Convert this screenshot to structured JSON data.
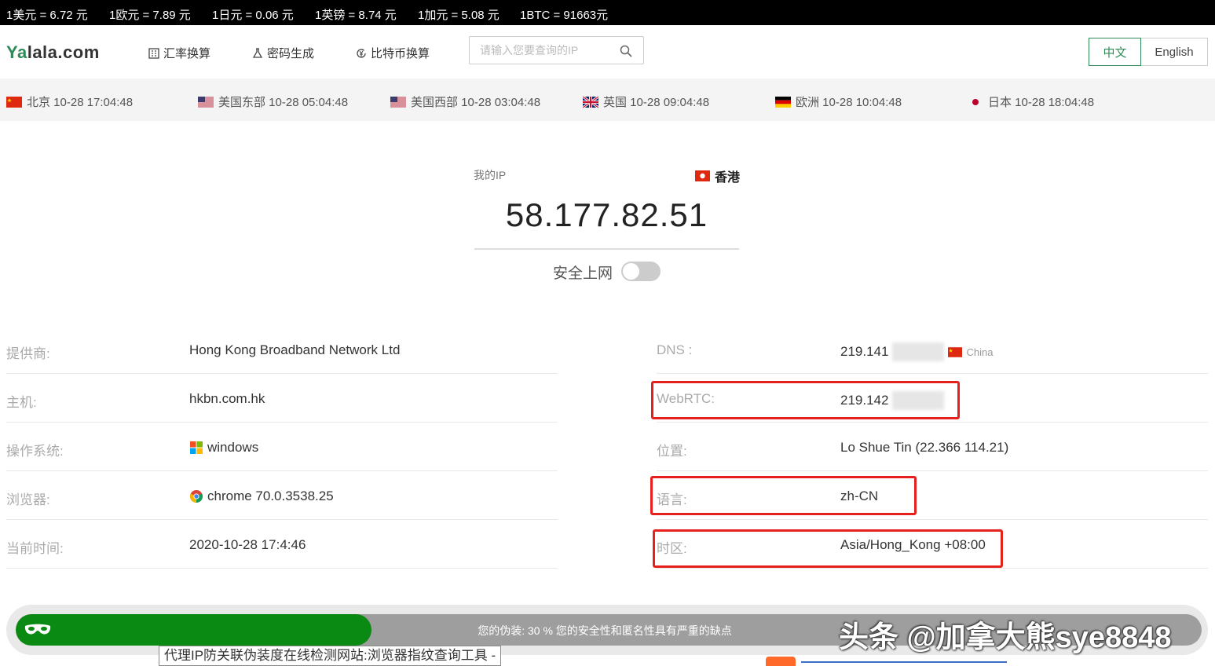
{
  "ticker": [
    "1美元 = 6.72 元",
    "1欧元 = 7.89 元",
    "1日元 = 0.06 元",
    "1英镑 = 8.74 元",
    "1加元 = 5.08 元",
    "1BTC = 91663元"
  ],
  "header": {
    "logo_prefix": "Ya",
    "logo_mid": "lala",
    "logo_suffix": ".com",
    "nav": [
      "汇率换算",
      "密码生成",
      "比特币换算"
    ],
    "search_placeholder": "请输入您要查询的IP",
    "lang_zh": "中文",
    "lang_en": "English"
  },
  "timezones": [
    {
      "flag": "cn",
      "label": "北京 10-28 17:04:48"
    },
    {
      "flag": "us",
      "label": "美国东部 10-28 05:04:48"
    },
    {
      "flag": "us",
      "label": "美国西部 10-28 03:04:48"
    },
    {
      "flag": "uk",
      "label": "英国 10-28 09:04:48"
    },
    {
      "flag": "de",
      "label": "欧洲 10-28 10:04:48"
    },
    {
      "flag": "jp",
      "label": "日本 10-28 18:04:48"
    }
  ],
  "hero": {
    "my_ip_label": "我的IP",
    "region": "香港",
    "ip": "58.177.82.51",
    "safe_label": "安全上网",
    "safe_enabled": false
  },
  "left_info": [
    {
      "key": "提供商:",
      "value": "Hong Kong Broadband Network Ltd",
      "icon": ""
    },
    {
      "key": "主机:",
      "value": "hkbn.com.hk",
      "icon": ""
    },
    {
      "key": "操作系统:",
      "value": "windows",
      "icon": "windows-icon"
    },
    {
      "key": "浏览器:",
      "value": "chrome 70.0.3538.25",
      "icon": "chrome-icon"
    },
    {
      "key": "当前时间:",
      "value": "2020-10-28 17:4:46",
      "icon": ""
    }
  ],
  "right_info": [
    {
      "key": "DNS :",
      "value": "219.141",
      "extra": "China",
      "redacted": true
    },
    {
      "key": "WebRTC:",
      "value": "219.142",
      "redacted": true
    },
    {
      "key": "位置:",
      "value": "Lo Shue Tin (22.366 114.21)"
    },
    {
      "key": "语言:",
      "value": "zh-CN"
    },
    {
      "key": "时区:",
      "value": "Asia/Hong_Kong +08:00"
    }
  ],
  "disguise": {
    "percent": 30,
    "text": "您的伪装: 30 % 您的安全性和匿名性具有严重的缺点"
  },
  "watermark": "头条 @加拿大熊sye8848",
  "tooltip": "代理IP防关联伪装度在线检测网站:浏览器指纹查询工具 -",
  "colors": {
    "accent": "#2e8b57",
    "progress": "#0a8a12",
    "highlight": "#e5201d"
  }
}
